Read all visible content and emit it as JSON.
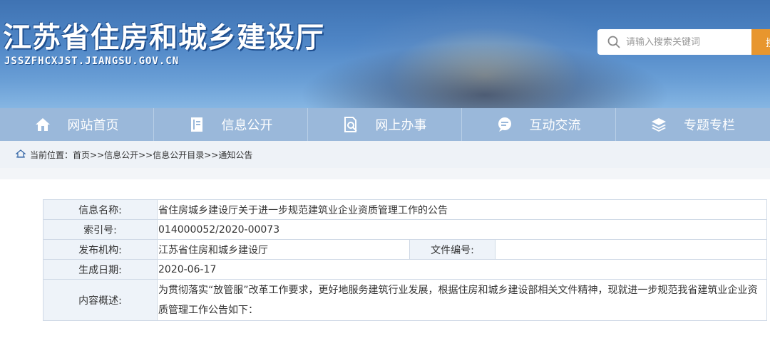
{
  "header": {
    "site_title": "江苏省住房和城乡建设厅",
    "site_domain": "JSSZFHCXJST.JIANGSU.GOV.CN",
    "search_placeholder": "请输入搜索关键词",
    "search_button": "搜"
  },
  "nav": {
    "items": [
      {
        "label": "网站首页",
        "icon": "home-icon"
      },
      {
        "label": "信息公开",
        "icon": "document-icon"
      },
      {
        "label": "网上办事",
        "icon": "search-document-icon"
      },
      {
        "label": "互动交流",
        "icon": "chat-icon"
      },
      {
        "label": "专题专栏",
        "icon": "layers-icon"
      }
    ]
  },
  "breadcrumb": {
    "label": "当前位置：",
    "path": "首页>>信息公开>>信息公开目录>>通知公告"
  },
  "info": {
    "name_label": "信息名称:",
    "name_value": "省住房城乡建设厅关于进一步规范建筑业企业资质管理工作的公告",
    "index_label": "索引号:",
    "index_value": "014000052/2020-00073",
    "publisher_label": "发布机构:",
    "publisher_value": "江苏省住房和城乡建设厅",
    "docno_label": "文件编号:",
    "docno_value": "",
    "date_label": "生成日期:",
    "date_value": "2020-06-17",
    "summary_label": "内容概述:",
    "summary_value": "为贯彻落实“放管服”改革工作要求，更好地服务建筑行业发展，根据住房和城乡建设部相关文件精神，现就进一步规范我省建筑业企业资质管理工作公告如下："
  }
}
